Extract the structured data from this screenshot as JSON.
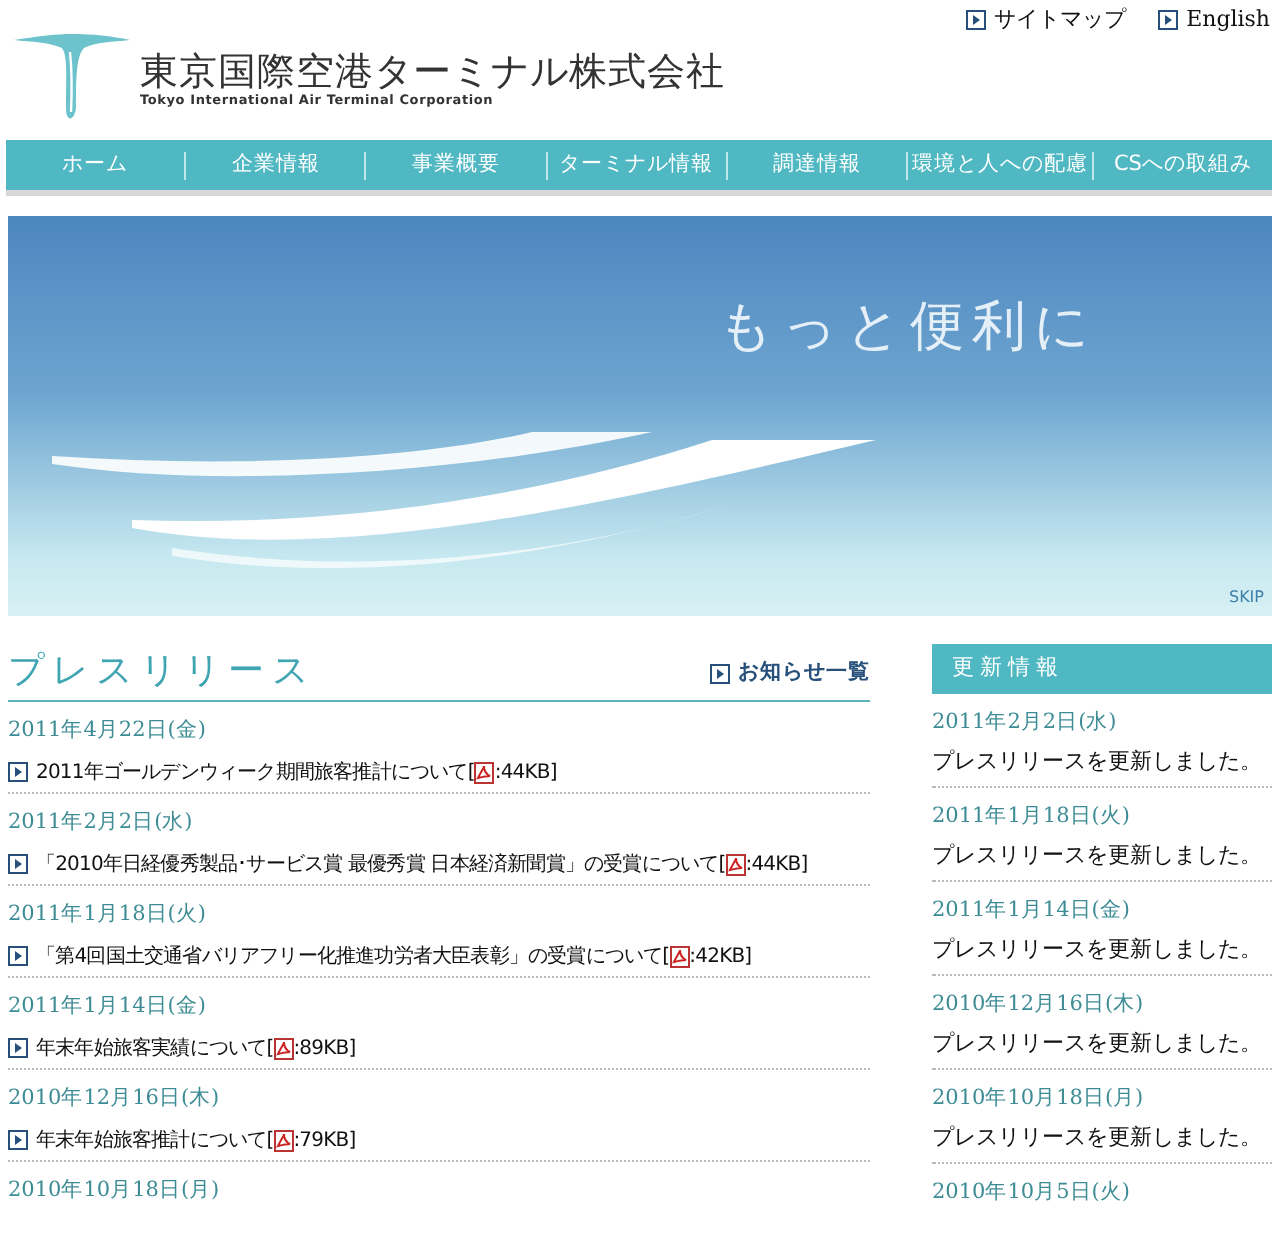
{
  "top_links": [
    {
      "label": "サイトマップ"
    },
    {
      "label": "English"
    }
  ],
  "logo": {
    "name_ja": "東京国際空港ターミナル株式会社",
    "name_en": "Tokyo International Air Terminal Corporation"
  },
  "nav": [
    {
      "label": "ホーム"
    },
    {
      "label": "企業情報"
    },
    {
      "label": "事業概要"
    },
    {
      "label": "ターミナル情報"
    },
    {
      "label": "調達情報"
    },
    {
      "label": "環境と人への配慮"
    },
    {
      "label": "CSへの取組み"
    }
  ],
  "hero": {
    "headline": "もっと便利に",
    "skip": "SKIP"
  },
  "press": {
    "title": "プレスリリース",
    "more_link": "お知らせ一覧",
    "items": [
      {
        "date": "2011年4月22日(金)",
        "title": "2011年ゴールデンウィーク期間旅客推計について[",
        "size": ":44KB]"
      },
      {
        "date": "2011年2月2日(水)",
        "title": "「2010年日経優秀製品･サービス賞 最優秀賞 日本経済新聞賞」の受賞について[",
        "size": ":44KB]"
      },
      {
        "date": "2011年1月18日(火)",
        "title": "「第4回国土交通省バリアフリー化推進功労者大臣表彰」の受賞について[",
        "size": ":42KB]"
      },
      {
        "date": "2011年1月14日(金)",
        "title": "年末年始旅客実績について[",
        "size": ":89KB]"
      },
      {
        "date": "2010年12月16日(木)",
        "title": "年末年始旅客推計について[",
        "size": ":79KB]"
      },
      {
        "date": "2010年10月18日(月)"
      }
    ]
  },
  "updates": {
    "title": "更新情報",
    "items": [
      {
        "date": "2011年2月2日(水)",
        "text": "プレスリリースを更新しました。"
      },
      {
        "date": "2011年1月18日(火)",
        "text": "プレスリリースを更新しました。"
      },
      {
        "date": "2011年1月14日(金)",
        "text": "プレスリリースを更新しました。"
      },
      {
        "date": "2010年12月16日(木)",
        "text": "プレスリリースを更新しました。"
      },
      {
        "date": "2010年10月18日(月)",
        "text": "プレスリリースを更新しました。"
      },
      {
        "date": "2010年10月5日(火)"
      }
    ]
  }
}
